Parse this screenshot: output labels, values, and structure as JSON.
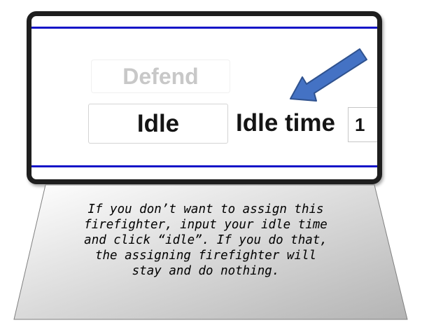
{
  "panel": {
    "defend_label": "Defend",
    "idle_label": "Idle",
    "idle_time_label": "Idle time",
    "idle_time_value": "1"
  },
  "colors": {
    "frame_border": "#1e1e1e",
    "accent_line": "#1515c8",
    "arrow": "#4472c4",
    "caption_box_light": "#ffffff",
    "caption_box_dark": "#b4b4b4"
  },
  "icons": {
    "pointer": "arrow-icon"
  },
  "caption": {
    "text": "If you don’t want to assign this\nfirefighter, input your idle time\nand click “idle”. If you do that,\nthe assigning firefighter will\nstay and do nothing."
  }
}
